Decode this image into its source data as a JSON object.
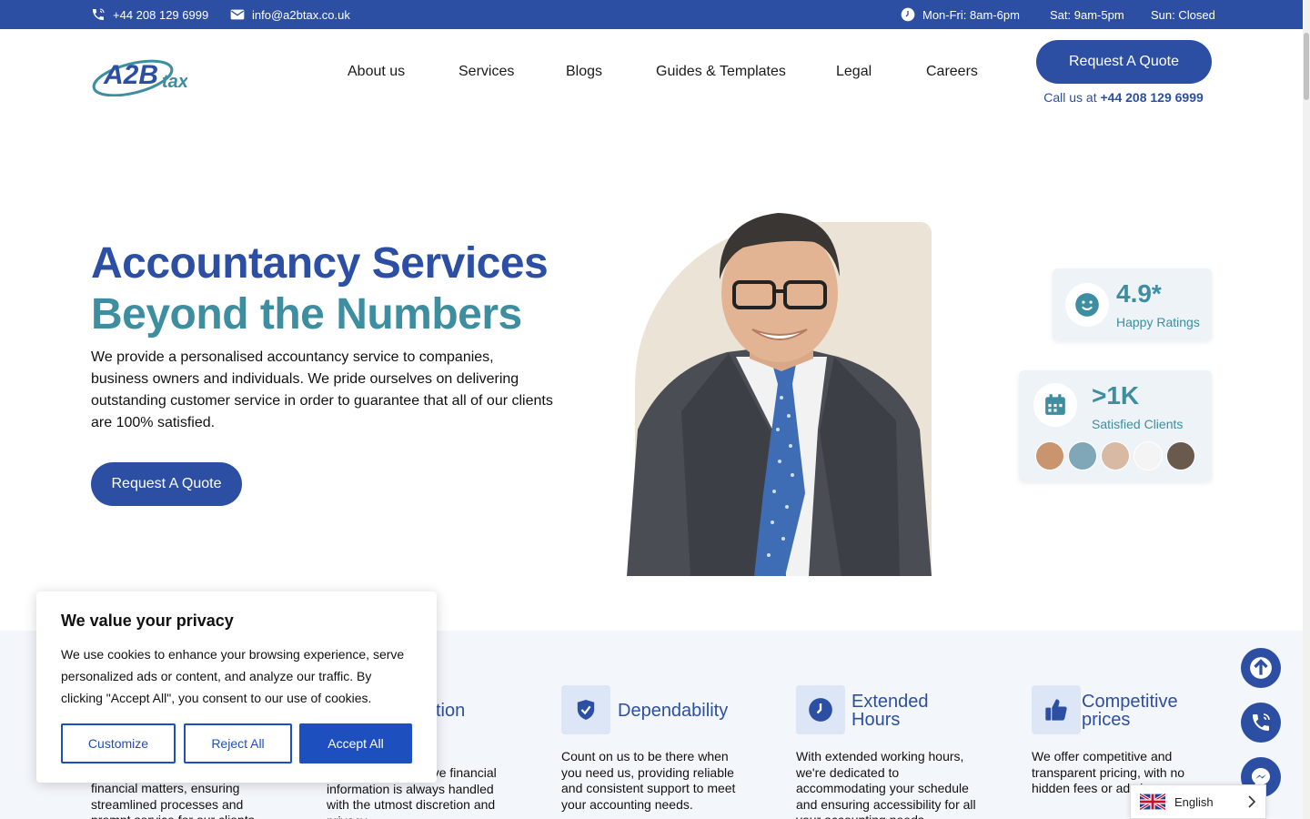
{
  "topbar": {
    "phone": "+44 208 129 6999",
    "email": "info@a2btax.co.uk",
    "hours_weekday": "Mon-Fri: 8am-6pm",
    "hours_sat": "Sat: 9am-5pm",
    "hours_sun": "Sun: Closed"
  },
  "logo": {
    "text_a2b": "A2B",
    "text_tax": "tax"
  },
  "nav": {
    "items": [
      {
        "label": "About us"
      },
      {
        "label": "Services"
      },
      {
        "label": "Blogs"
      },
      {
        "label": "Guides & Templates"
      },
      {
        "label": "Legal"
      },
      {
        "label": "Careers"
      }
    ]
  },
  "header": {
    "quote_label": "Request A Quote",
    "callus_prefix": "Call us at",
    "callus_number": "+44 208 129 6999"
  },
  "hero": {
    "title_line1": "Accountancy Services",
    "title_line2": "Beyond the Numbers",
    "description": "We provide a personalised accountancy service to companies, business owners and individuals. We pride ourselves on delivering outstanding customer service in order to guarantee that all of our clients are 100% satisfied.",
    "quote_label": "Request A Quote"
  },
  "stats": {
    "rating_value": "4.9*",
    "rating_label": "Happy Ratings",
    "clients_value": ">1K",
    "clients_label": "Satisfied Clients"
  },
  "features": [
    {
      "title": "",
      "text": "financial matters, ensuring streamlined processes and prompt service for our clients."
    },
    {
      "title": "tion",
      "text": "ns that your sensitive financial information is always handled with the utmost discretion and privacy."
    },
    {
      "title": "Dependability",
      "text": "Count on us to be there when you need us, providing reliable and consistent support to meet your accounting needs."
    },
    {
      "title_line1": "Extended",
      "title_line2": "Hours",
      "text": "With extended working hours, we're dedicated to accommodating your schedule and ensuring accessibility for all your accounting needs."
    },
    {
      "title_line1": "Competitive",
      "title_line2": "prices",
      "text": "We offer competitive and transparent pricing, with no hidden fees or ad charges."
    }
  ],
  "cookie": {
    "title": "We value your privacy",
    "text": "We use cookies to enhance your browsing experience, serve personalized ads or content, and analyze our traffic. By clicking \"Accept All\", you consent to our use of cookies.",
    "customize": "Customize",
    "reject": "Reject All",
    "accept": "Accept All"
  },
  "language": {
    "selected": "English"
  },
  "colors": {
    "brand_blue": "#2c4fa3",
    "brand_teal": "#3d8ea0",
    "cookie_blue": "#1e4fbf"
  }
}
